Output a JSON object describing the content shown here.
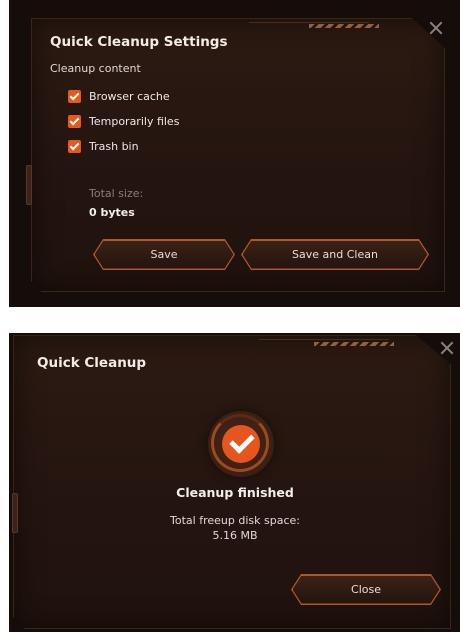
{
  "settings_dialog": {
    "title": "Quick Cleanup Settings",
    "section_label": "Cleanup content",
    "options": [
      {
        "label": "Browser cache",
        "checked": true
      },
      {
        "label": "Temporarily files",
        "checked": true
      },
      {
        "label": "Trash bin",
        "checked": true
      }
    ],
    "total_size_label": "Total size:",
    "total_size_value": "0 bytes",
    "save_label": "Save",
    "save_clean_label": "Save and Clean"
  },
  "result_dialog": {
    "title": "Quick Cleanup",
    "status": "Cleanup finished",
    "freeup_label": "Total freeup disk space:",
    "freeup_value": "5.16 MB",
    "close_label": "Close"
  },
  "colors": {
    "accent": "#e35a1e",
    "button_border": "#b0562a",
    "background": "#150d0a"
  },
  "icons": {
    "close": "close-icon",
    "check": "checkmark-icon",
    "done": "cleanup-complete-icon"
  }
}
